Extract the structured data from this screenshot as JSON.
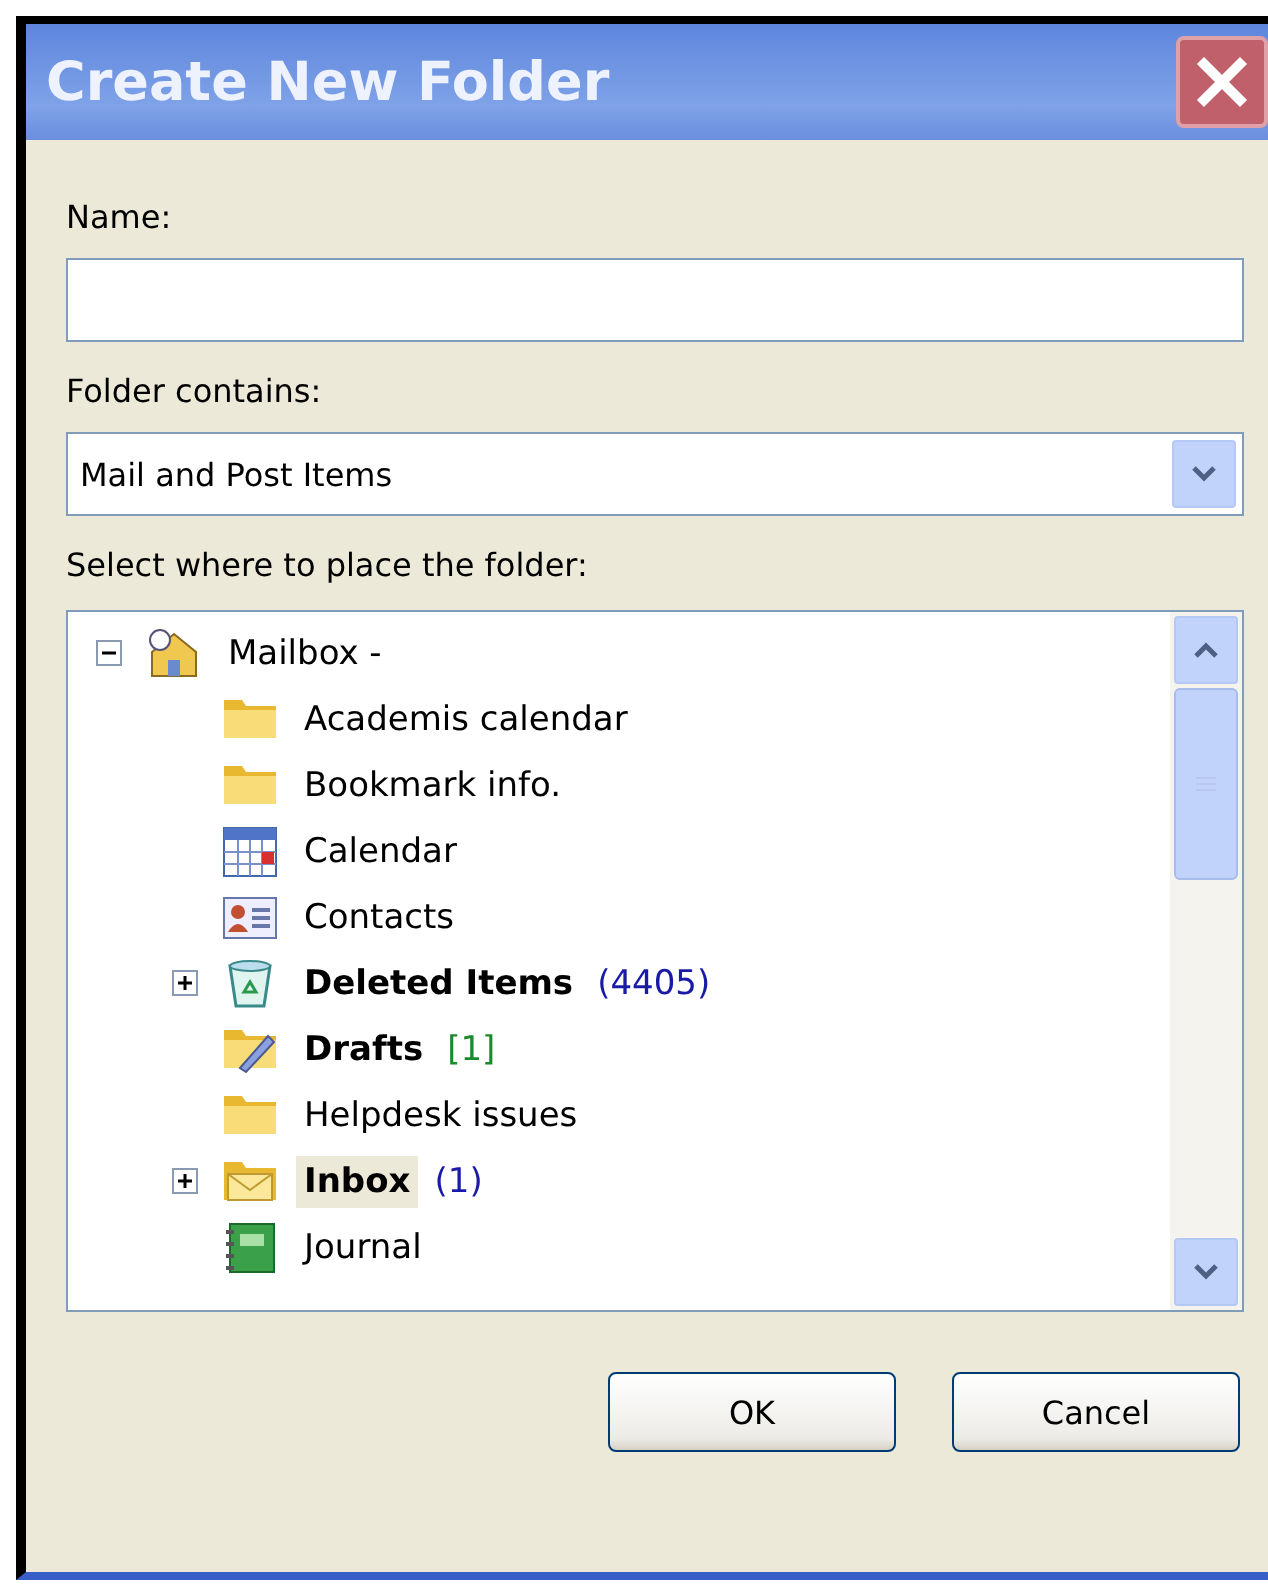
{
  "window": {
    "title": "Create New Folder"
  },
  "name_field": {
    "label": "Name:"
  },
  "folder_contains": {
    "label": "Folder contains:",
    "value": "Mail and Post Items"
  },
  "location": {
    "label": "Select where to place the folder:",
    "tree": [
      {
        "kind": "mailbox",
        "label": "Mailbox -",
        "bold": false,
        "selected": false,
        "expanded": true,
        "children": [
          {
            "kind": "folder",
            "label": "Academis calendar",
            "bold": false,
            "selected": false
          },
          {
            "kind": "folder",
            "label": "Bookmark info.",
            "bold": false,
            "selected": false
          },
          {
            "kind": "calendar",
            "label": "Calendar",
            "bold": false,
            "selected": false
          },
          {
            "kind": "contacts",
            "label": "Contacts",
            "bold": false,
            "selected": false
          },
          {
            "kind": "trash",
            "label": "Deleted Items",
            "bold": true,
            "selected": false,
            "expanded": false,
            "count": "(4405)",
            "color": "#1a1aa8"
          },
          {
            "kind": "drafts",
            "label": "Drafts",
            "bold": true,
            "selected": false,
            "count": "[1]",
            "color": "#1a8a2a"
          },
          {
            "kind": "folder",
            "label": "Helpdesk issues",
            "bold": false,
            "selected": false
          },
          {
            "kind": "inbox",
            "label": "Inbox",
            "bold": true,
            "selected": true,
            "expanded": false,
            "count": "(1)",
            "color": "#1a1aa8"
          },
          {
            "kind": "journal",
            "label": "Journal",
            "bold": false,
            "selected": false
          }
        ]
      }
    ]
  },
  "buttons": [
    {
      "label": "OK"
    },
    {
      "label": "Cancel"
    }
  ]
}
